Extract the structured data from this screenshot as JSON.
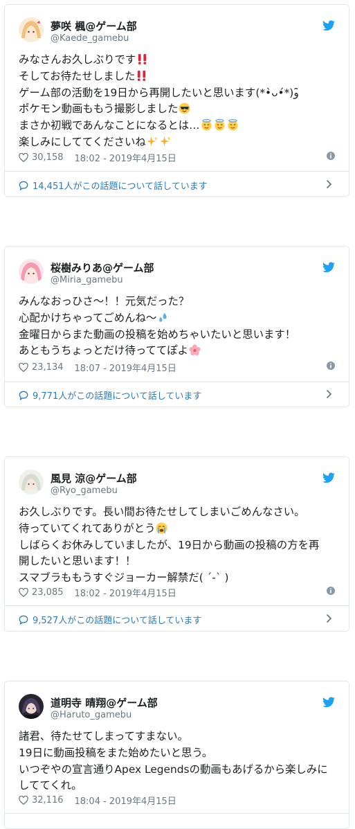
{
  "tweets": [
    {
      "name": "夢咲 楓@ゲーム部",
      "handle": "@Kaede_gamebu",
      "avatar_color": "#f6d9b9",
      "lines": [
        "みなさんお久しぶりです",
        "そしてお待たせしました",
        "ゲーム部の活動を19日から再開したいと思います(*•̀ᴗ•́*)و ̑̑",
        "ポケモン動画ももう撮影しました",
        "まさか初戦であんなことになるとは…",
        "楽しみにしててくださいね"
      ],
      "likes": "30,158",
      "time": "18:02 - 2019年4月15日",
      "conversation": "14,451人がこの話題について話しています"
    },
    {
      "name": "桜樹みりあ@ゲーム部",
      "handle": "@Miria_gamebu",
      "avatar_color": "#f5b7c7",
      "lines": [
        "みんなおっひさ〜！！元気だった？",
        "心配かけちゃってごめんね〜",
        "金曜日からまた動画の投稿を始めちゃいたいと思います！",
        "あともうちょっとだけ待っててぽよ"
      ],
      "likes": "23,134",
      "time": "18:07 - 2019年4月15日",
      "conversation": "9,771人がこの話題について話しています"
    },
    {
      "name": "風見 涼@ゲーム部",
      "handle": "@Ryo_gamebu",
      "avatar_color": "#dfe6da",
      "lines": [
        "お久しぶりです。長い間お待たせしてしまいごめんなさい。",
        "待っていてくれてありがとう",
        "しばらくお休みしていましたが、19日から動画の投稿の方を再",
        "開したいと思います！！",
        "スマブラももうすぐジョーカー解禁だ( ´-`  )"
      ],
      "likes": "23,085",
      "time": "18:02 - 2019年4月15日",
      "conversation": "9,527人がこの話題について話しています"
    },
    {
      "name": "道明寺 晴翔@ゲーム部",
      "handle": "@Haruto_gamebu",
      "avatar_color": "#2a2430",
      "lines": [
        "諸君、待たせてしまってすまない。",
        "19日に動画投稿をまた始めたいと思う。",
        "いつぞやの宣言通りApex Legendsの動画もあげるから楽しみに",
        "しててくれ。"
      ],
      "likes": "32,116",
      "time": "18:04 - 2019年4月15日",
      "conversation": ""
    }
  ],
  "colors": {
    "twitter_blue": "#1da1f2",
    "link_blue": "#2b7bb9",
    "meta_gray": "#697882",
    "border": "#e1e8ed"
  }
}
